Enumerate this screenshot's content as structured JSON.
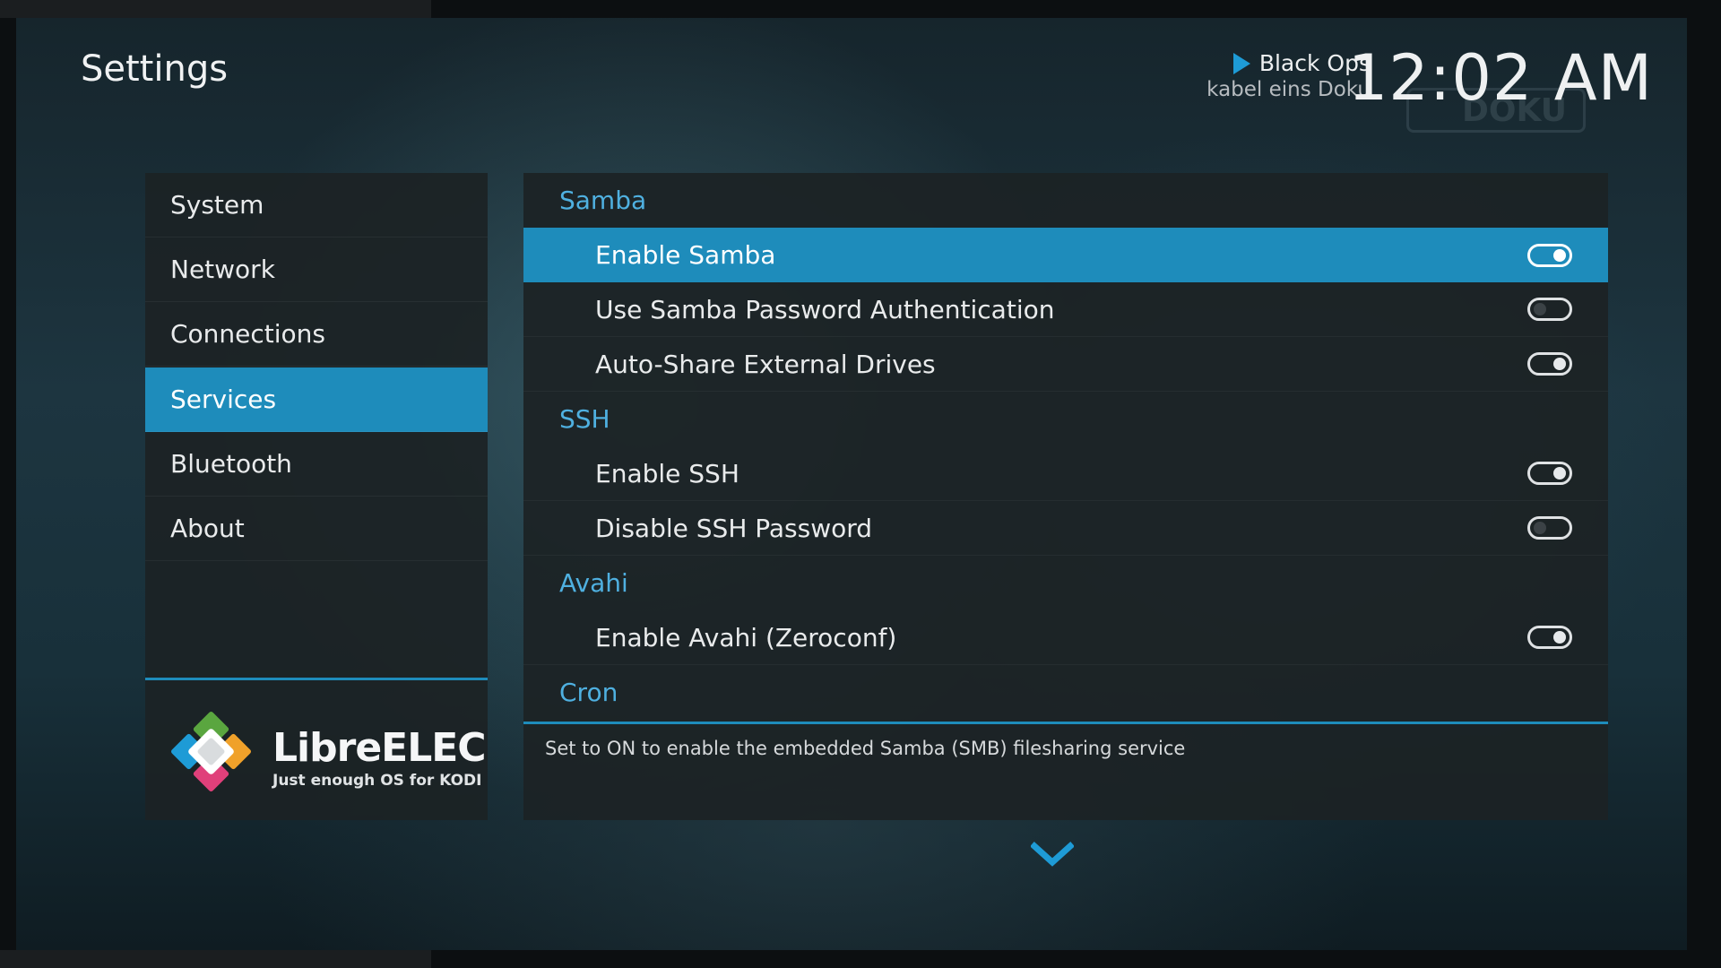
{
  "header": {
    "page_title": "Settings",
    "now_playing_title": "Black Ops",
    "now_playing_channel": "kabel eins Doku",
    "clock": "12:02 AM",
    "watermark": "DOKU"
  },
  "sidebar": {
    "items": [
      {
        "label": "System"
      },
      {
        "label": "Network"
      },
      {
        "label": "Connections"
      },
      {
        "label": "Services",
        "active": true
      },
      {
        "label": "Bluetooth"
      },
      {
        "label": "About"
      }
    ],
    "logo_name": "LibreELEC",
    "logo_tagline": "Just enough OS for KODI"
  },
  "panel": {
    "sections": [
      {
        "title": "Samba",
        "settings": [
          {
            "label": "Enable Samba",
            "state": "on",
            "focused": true
          },
          {
            "label": "Use Samba Password Authentication",
            "state": "off"
          },
          {
            "label": "Auto-Share External Drives",
            "state": "on"
          }
        ]
      },
      {
        "title": "SSH",
        "settings": [
          {
            "label": "Enable SSH",
            "state": "on"
          },
          {
            "label": "Disable SSH Password",
            "state": "off"
          }
        ]
      },
      {
        "title": "Avahi",
        "settings": [
          {
            "label": "Enable Avahi (Zeroconf)",
            "state": "on"
          }
        ]
      },
      {
        "title": "Cron",
        "settings": []
      }
    ],
    "description": "Set to ON to enable the embedded Samba (SMB) filesharing service"
  },
  "icons": {
    "play": "play-icon",
    "scroll_down": "chevron-down-icon",
    "logo": "librelec-logo-icon"
  },
  "colors": {
    "accent": "#1e8cbb",
    "section_text": "#4fb0e0",
    "logo_green": "#5aa63f",
    "logo_orange": "#f0a12a",
    "logo_blue": "#1e9bd6",
    "logo_pink": "#e0407a"
  }
}
